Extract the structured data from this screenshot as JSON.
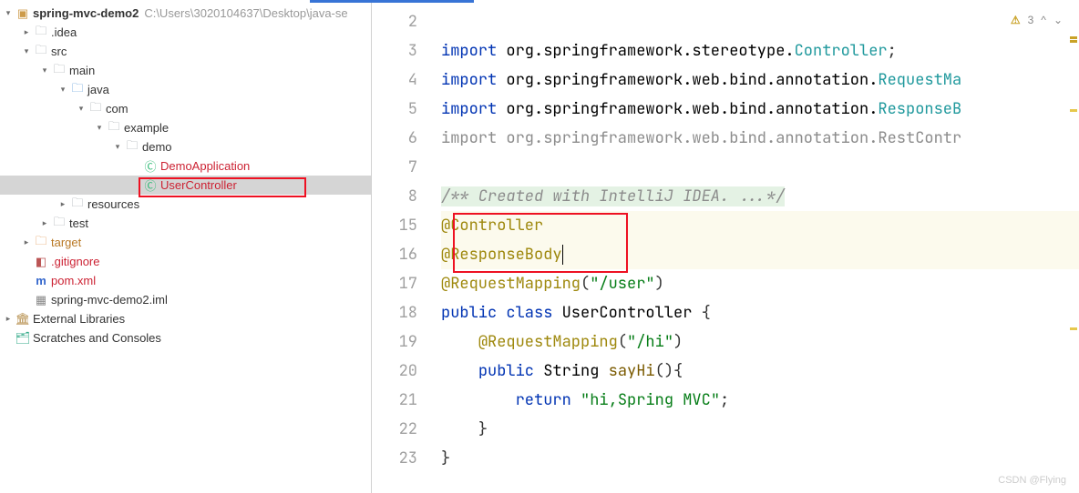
{
  "tree": {
    "root": {
      "label": "spring-mvc-demo2",
      "path": "C:\\Users\\3020104637\\Desktop\\java-se"
    },
    "idea": ".idea",
    "src": "src",
    "main": "main",
    "java": "java",
    "com": "com",
    "example": "example",
    "demo": "demo",
    "demoApp": "DemoApplication",
    "userCtl": "UserController",
    "resources": "resources",
    "test": "test",
    "target": "target",
    "gitignore": ".gitignore",
    "pom": "pom.xml",
    "iml": "spring-mvc-demo2.iml",
    "ext": "External Libraries",
    "scratch": "Scratches and Consoles"
  },
  "gutter": {
    "l2": "2",
    "l3": "3",
    "l4": "4",
    "l5": "5",
    "l6": "6",
    "l7": "7",
    "l8": "8",
    "l15": "15",
    "l16": "16",
    "l17": "17",
    "l18": "18",
    "l19": "19",
    "l20": "20",
    "l21": "21",
    "l22": "22",
    "l23": "23"
  },
  "code": {
    "import": "import",
    "pkg_stereo": " org.springframework.stereotype.",
    "controller": "Controller",
    "pkg_web": " org.springframework.web.bind.annotation.",
    "reqMap": "RequestMa",
    "respBody": "ResponseB",
    "restCtr": "RestContr",
    "doc": "/** Created with IntelliJ IDEA. ...*/",
    "atController": "@Controller",
    "atResponseBody": "@ResponseBody",
    "atRequestMapping": "@RequestMapping",
    "userPath": "\"/user\"",
    "hiPath": "\"/hi\"",
    "public": "public",
    "class": "class",
    "clsName": "UserController",
    "String": "String",
    "sayHi": "sayHi",
    "return": "return",
    "retStr": "\"hi,Spring MVC\"",
    "semi": ";",
    "open": "{",
    "close": "}",
    "paren": "()",
    "parenOpen": "(",
    "parenClose": ")"
  },
  "inspections": {
    "warnCount": "3",
    "up": "^",
    "down": "⌄"
  },
  "watermark": "CSDN @Flying"
}
